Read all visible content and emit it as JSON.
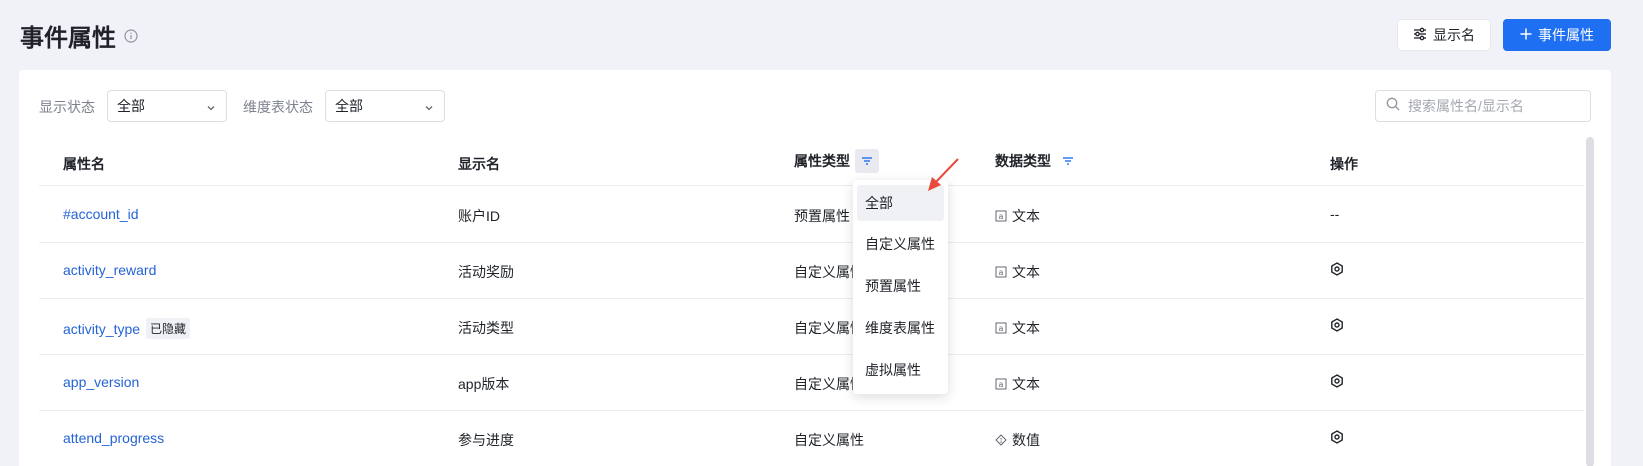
{
  "header": {
    "title": "事件属性",
    "display_name_button": "显示名",
    "add_button": "事件属性"
  },
  "filters": {
    "display_status_label": "显示状态",
    "display_status_value": "全部",
    "dim_table_status_label": "维度表状态",
    "dim_table_status_value": "全部",
    "search_placeholder": "搜索属性名/显示名"
  },
  "table": {
    "columns": {
      "name": "属性名",
      "display_name": "显示名",
      "attr_type": "属性类型",
      "data_type": "数据类型",
      "actions": "操作"
    },
    "rows": [
      {
        "name": "#account_id",
        "tag": "",
        "display_name": "账户ID",
        "attr_type": "预置属性",
        "data_type": "文本",
        "data_type_icon": "text-icon",
        "action": "--"
      },
      {
        "name": "activity_reward",
        "tag": "",
        "display_name": "活动奖励",
        "attr_type": "自定义属性",
        "data_type": "文本",
        "data_type_icon": "text-icon",
        "action": "gear-icon"
      },
      {
        "name": "activity_type",
        "tag": "已隐藏",
        "display_name": "活动类型",
        "attr_type": "自定义属性",
        "data_type": "文本",
        "data_type_icon": "text-icon",
        "action": "gear-icon"
      },
      {
        "name": "app_version",
        "tag": "",
        "display_name": "app版本",
        "attr_type": "自定义属性",
        "data_type": "文本",
        "data_type_icon": "text-icon",
        "action": "gear-icon"
      },
      {
        "name": "attend_progress",
        "tag": "",
        "display_name": "参与进度",
        "attr_type": "自定义属性",
        "data_type": "数值",
        "data_type_icon": "number-icon",
        "action": "gear-icon"
      }
    ]
  },
  "attr_type_dropdown": {
    "options": [
      "全部",
      "自定义属性",
      "预置属性",
      "维度表属性",
      "虚拟属性"
    ],
    "selected": "全部"
  },
  "colors": {
    "primary": "#1f6ff2",
    "link": "#2463d6",
    "annotation_arrow": "#e84a3c"
  }
}
